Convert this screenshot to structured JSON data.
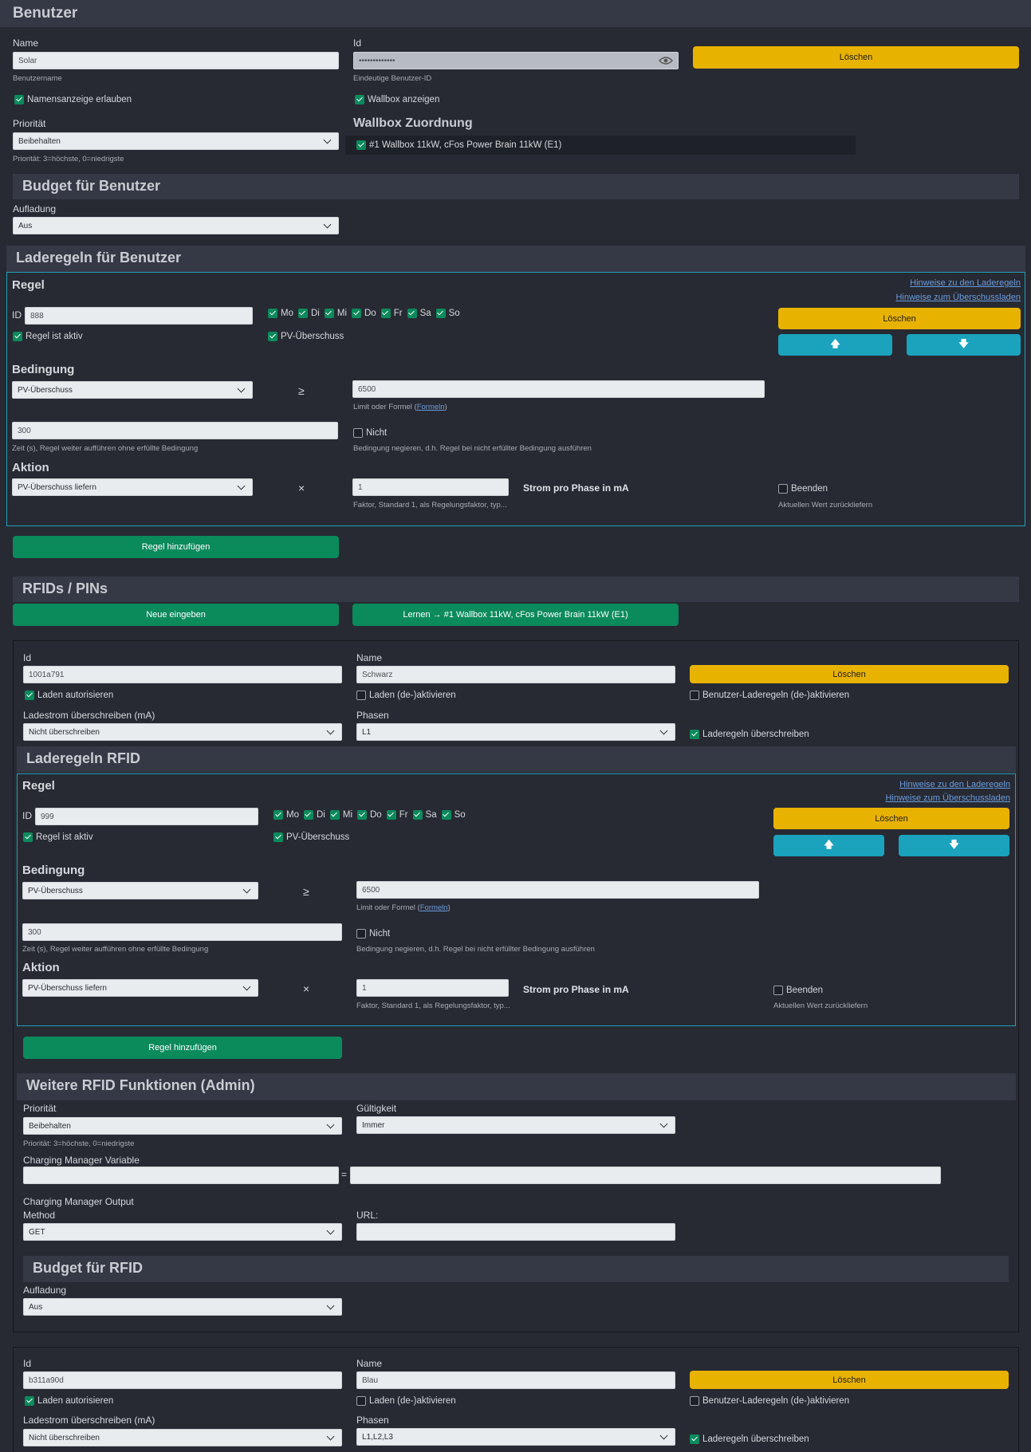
{
  "user": {
    "section_title": "Benutzer",
    "name_label": "Name",
    "name_value": "Solar",
    "name_hint": "Benutzername",
    "id_label": "Id",
    "id_value": "•••••••••••••",
    "id_hint": "Eindeutige Benutzer-ID",
    "delete_label": "Löschen",
    "allow_name": "Namensanzeige erlauben",
    "show_wallbox": "Wallbox anzeigen",
    "priority_label": "Priorität",
    "priority_value": "Beibehalten",
    "priority_hint": "Priorität: 3=höchste, 0=niedrigste",
    "wallbox_title": "Wallbox Zuordnung",
    "wallbox_item": "#1 Wallbox 11kW, cFos Power Brain 11kW (E1)",
    "budget_title": "Budget für Benutzer",
    "charging_label": "Aufladung",
    "charging_value": "Aus"
  },
  "user_rules": {
    "section_title": "Laderegeln für Benutzer",
    "rule_heading": "Regel",
    "link1": "Hinweise zu den Laderegeln",
    "link2": "Hinweise zum Überschussladen",
    "id_label": "ID",
    "id_value": "888",
    "days": [
      "Mo",
      "Di",
      "Mi",
      "Do",
      "Fr",
      "Sa",
      "So"
    ],
    "active_label": "Regel ist aktiv",
    "pv_label": "PV-Überschuss",
    "delete_label": "Löschen",
    "condition_heading": "Bedingung",
    "condition_value": "PV-Überschuss",
    "ge_symbol": "≥",
    "limit_value": "6500",
    "limit_hint_prefix": "Limit oder Formel (",
    "limit_hint_link": "Formeln",
    "limit_hint_suffix": ")",
    "time_value": "300",
    "time_hint": "Zeit (s), Regel weiter aufführen ohne erfüllte Bedingung",
    "not_label": "Nicht",
    "not_hint": "Bedingung negieren, d.h. Regel bei nicht erfüllter Bedingung ausführen",
    "action_heading": "Aktion",
    "action_value": "PV-Überschuss liefern",
    "times_symbol": "×",
    "factor_value": "1",
    "factor_hint": "Faktor, Standard 1, als Regelungsfaktor, typ...",
    "current_label": "Strom pro Phase in mA",
    "end_label": "Beenden",
    "end_hint": "Aktuellen Wert zurückliefern",
    "add_rule": "Regel hinzufügen"
  },
  "rfids": {
    "section_title": "RFIDs / PINs",
    "new_button": "Neue eingeben",
    "learn_button": "Lernen → #1 Wallbox 11kW, cFos Power Brain 11kW (E1)"
  },
  "rfid1": {
    "id_label": "Id",
    "id_value": "1001a791",
    "name_label": "Name",
    "name_value": "Schwarz",
    "delete_label": "Löschen",
    "auth_label": "Laden autorisieren",
    "toggle_label": "Laden (de-)aktivieren",
    "user_rules_label": "Benutzer-Laderegeln (de-)aktivieren",
    "current_label": "Ladestrom überschreiben (mA)",
    "current_value": "Nicht überschreiben",
    "phases_label": "Phasen",
    "phases_value": "L1",
    "override_label": "Laderegeln überschreiben"
  },
  "rfid_rules": {
    "section_title": "Laderegeln RFID",
    "rule_heading": "Regel",
    "link1": "Hinweise zu den Laderegeln",
    "link2": "Hinweise zum Überschussladen",
    "id_label": "ID",
    "id_value": "999",
    "days": [
      "Mo",
      "Di",
      "Mi",
      "Do",
      "Fr",
      "Sa",
      "So"
    ],
    "active_label": "Regel ist aktiv",
    "pv_label": "PV-Überschuss",
    "delete_label": "Löschen",
    "condition_heading": "Bedingung",
    "condition_value": "PV-Überschuss",
    "ge_symbol": "≥",
    "limit_value": "6500",
    "limit_hint_prefix": "Limit oder Formel (",
    "limit_hint_link": "Formeln",
    "limit_hint_suffix": ")",
    "time_value": "300",
    "time_hint": "Zeit (s), Regel weiter aufführen ohne erfüllte Bedingung",
    "not_label": "Nicht",
    "not_hint": "Bedingung negieren, d.h. Regel bei nicht erfüllter Bedingung ausführen",
    "action_heading": "Aktion",
    "action_value": "PV-Überschuss liefern",
    "times_symbol": "×",
    "factor_value": "1",
    "factor_hint": "Faktor, Standard 1, als Regelungsfaktor, typ...",
    "current_label": "Strom pro Phase in mA",
    "end_label": "Beenden",
    "end_hint": "Aktuellen Wert zurückliefern",
    "add_rule": "Regel hinzufügen"
  },
  "rfid_more": {
    "section_title": "Weitere RFID Funktionen (Admin)",
    "priority_label": "Priorität",
    "priority_value": "Beibehalten",
    "priority_hint": "Priorität: 3=höchste, 0=niedrigste",
    "validity_label": "Gültigkeit",
    "validity_value": "Immer",
    "var_label": "Charging Manager Variable",
    "eq_symbol": "=",
    "output_label": "Charging Manager Output",
    "method_label": "Method",
    "method_value": "GET",
    "url_label": "URL:",
    "budget_title": "Budget für RFID",
    "charging_label": "Aufladung",
    "charging_value": "Aus"
  },
  "rfid2": {
    "id_label": "Id",
    "id_value": "b311a90d",
    "name_label": "Name",
    "name_value": "Blau",
    "delete_label": "Löschen",
    "auth_label": "Laden autorisieren",
    "toggle_label": "Laden (de-)aktivieren",
    "user_rules_label": "Benutzer-Laderegeln (de-)aktivieren",
    "current_label": "Ladestrom überschreiben (mA)",
    "current_value": "Nicht überschreiben",
    "phases_label": "Phasen",
    "phases_value": "L1,L2,L3",
    "override_label": "Laderegeln überschreiben"
  },
  "colors": {
    "accent": "#0b8a5c",
    "warning": "#e8b200",
    "info": "#1ba2bd",
    "frame": "#1f9fb5",
    "background": "#272a33"
  }
}
